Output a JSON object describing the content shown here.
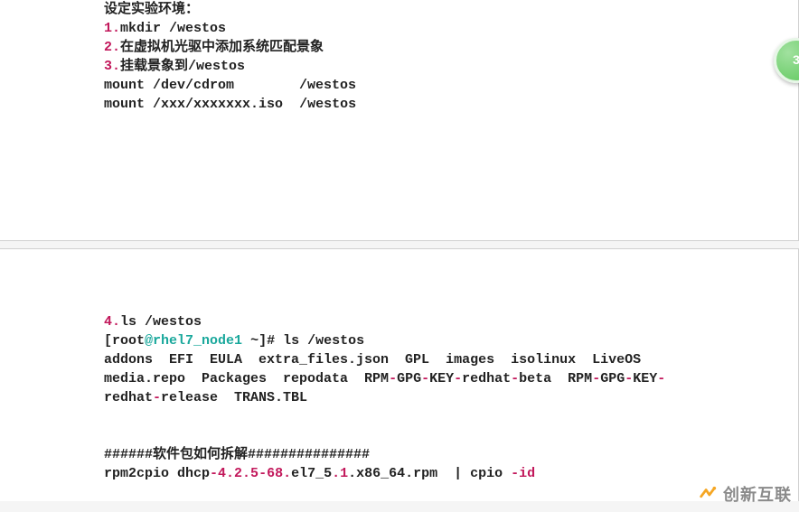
{
  "badge": "3",
  "card1": {
    "l0": "设定实验环境：",
    "s1_n": "1.",
    "s1_t": "mkdir /westos",
    "s2_n": "2.",
    "s2_t": "在虚拟机光驱中添加系统匹配景象",
    "s3_n": "3.",
    "s3_t": "挂载景象到/westos",
    "m1_pre": "mount ",
    "m1_path": "/dev/cdrom",
    "m1_pad": "        ",
    "m1_dst": "/westos",
    "m2_pre": "mount ",
    "m2_path": "/xxx/xxxxxxx.iso",
    "m2_pad": "  ",
    "m2_dst": "/westos"
  },
  "card2": {
    "s4_n": "4.",
    "s4_t": "ls /westos",
    "prompt_open": "[root",
    "prompt_at": "@",
    "prompt_host": "rhel7_node1",
    "prompt_tail": " ~]# ls /westos",
    "ls1": "addons  EFI  EULA  extra_files.json  GPL  images  isolinux  LiveOS",
    "ls2a": "media.repo  Packages  repodata  RPM",
    "ls2b": "GPG",
    "ls2c": "KEY",
    "ls2d": "redhat",
    "ls2e": "beta  RPM",
    "ls2f": "GPG",
    "ls2g": "KEY",
    "ls3a": "redhat",
    "ls3b": "release  TRANS.TBL",
    "h_pre": "######",
    "h_txt": "软件包如何拆解",
    "h_suf": "###############",
    "cpio_a": "rpm2cpio dhcp",
    "cpio_v1": "4.2.5",
    "cpio_v2": "68.",
    "cpio_tag": "el7_5",
    "cpio_dot": ".1",
    "cpio_arch": ".x86_64.rpm  | cpio ",
    "cpio_flag": "-id"
  },
  "watermark": "创新互联"
}
